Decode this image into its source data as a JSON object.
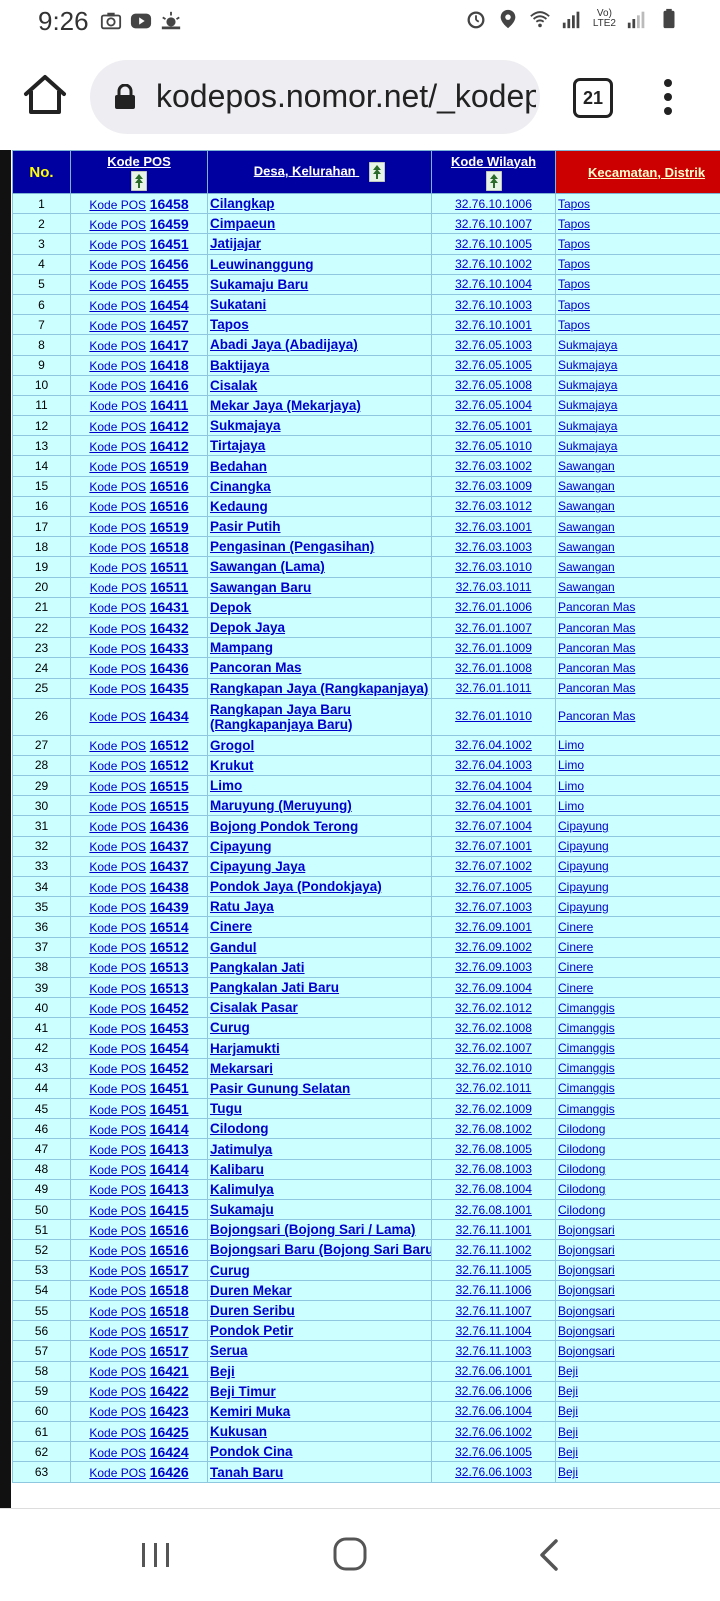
{
  "status_bar": {
    "time": "9:26",
    "left_icons": [
      "photo-icon",
      "youtube-icon",
      "weather-icon"
    ],
    "right_icons": [
      "alarm-icon",
      "location-icon",
      "wifi-icon",
      "signal-icon",
      "battery-icon"
    ],
    "network_label_top": "Vo)",
    "network_label_bottom": "LTE2"
  },
  "browser": {
    "url": "kodepos.nomor.net/_kodep",
    "tab_count": "21"
  },
  "table": {
    "headers": {
      "no": "No.",
      "kode_pos": "Kode POS",
      "desa": "Desa, Kelurahan",
      "wilayah": "Kode Wilayah",
      "kecamatan": "Kecamatan, Distrik"
    },
    "kode_pos_prefix": "Kode POS",
    "rows": [
      {
        "no": "1",
        "kode": "16458",
        "desa": "Cilangkap",
        "wilayah": "32.76.10.1006",
        "kec": "Tapos"
      },
      {
        "no": "2",
        "kode": "16459",
        "desa": "Cimpaeun",
        "wilayah": "32.76.10.1007",
        "kec": "Tapos"
      },
      {
        "no": "3",
        "kode": "16451",
        "desa": "Jatijajar",
        "wilayah": "32.76.10.1005",
        "kec": "Tapos"
      },
      {
        "no": "4",
        "kode": "16456",
        "desa": "Leuwinanggung",
        "wilayah": "32.76.10.1002",
        "kec": "Tapos"
      },
      {
        "no": "5",
        "kode": "16455",
        "desa": "Sukamaju Baru",
        "wilayah": "32.76.10.1004",
        "kec": "Tapos"
      },
      {
        "no": "6",
        "kode": "16454",
        "desa": "Sukatani",
        "wilayah": "32.76.10.1003",
        "kec": "Tapos"
      },
      {
        "no": "7",
        "kode": "16457",
        "desa": "Tapos",
        "wilayah": "32.76.10.1001",
        "kec": "Tapos"
      },
      {
        "no": "8",
        "kode": "16417",
        "desa": "Abadi Jaya (Abadijaya)",
        "wilayah": "32.76.05.1003",
        "kec": "Sukmajaya"
      },
      {
        "no": "9",
        "kode": "16418",
        "desa": "Baktijaya",
        "wilayah": "32.76.05.1005",
        "kec": "Sukmajaya"
      },
      {
        "no": "10",
        "kode": "16416",
        "desa": "Cisalak",
        "wilayah": "32.76.05.1008",
        "kec": "Sukmajaya"
      },
      {
        "no": "11",
        "kode": "16411",
        "desa": "Mekar Jaya (Mekarjaya)",
        "wilayah": "32.76.05.1004",
        "kec": "Sukmajaya"
      },
      {
        "no": "12",
        "kode": "16412",
        "desa": "Sukmajaya",
        "wilayah": "32.76.05.1001",
        "kec": "Sukmajaya"
      },
      {
        "no": "13",
        "kode": "16412",
        "desa": "Tirtajaya",
        "wilayah": "32.76.05.1010",
        "kec": "Sukmajaya"
      },
      {
        "no": "14",
        "kode": "16519",
        "desa": "Bedahan",
        "wilayah": "32.76.03.1002",
        "kec": "Sawangan"
      },
      {
        "no": "15",
        "kode": "16516",
        "desa": "Cinangka",
        "wilayah": "32.76.03.1009",
        "kec": "Sawangan"
      },
      {
        "no": "16",
        "kode": "16516",
        "desa": "Kedaung",
        "wilayah": "32.76.03.1012",
        "kec": "Sawangan"
      },
      {
        "no": "17",
        "kode": "16519",
        "desa": "Pasir Putih",
        "wilayah": "32.76.03.1001",
        "kec": "Sawangan"
      },
      {
        "no": "18",
        "kode": "16518",
        "desa": "Pengasinan (Pengasihan)",
        "wilayah": "32.76.03.1003",
        "kec": "Sawangan"
      },
      {
        "no": "19",
        "kode": "16511",
        "desa": "Sawangan (Lama)",
        "wilayah": "32.76.03.1010",
        "kec": "Sawangan"
      },
      {
        "no": "20",
        "kode": "16511",
        "desa": "Sawangan Baru",
        "wilayah": "32.76.03.1011",
        "kec": "Sawangan"
      },
      {
        "no": "21",
        "kode": "16431",
        "desa": "Depok",
        "wilayah": "32.76.01.1006",
        "kec": "Pancoran Mas"
      },
      {
        "no": "22",
        "kode": "16432",
        "desa": "Depok Jaya",
        "wilayah": "32.76.01.1007",
        "kec": "Pancoran Mas"
      },
      {
        "no": "23",
        "kode": "16433",
        "desa": "Mampang",
        "wilayah": "32.76.01.1009",
        "kec": "Pancoran Mas"
      },
      {
        "no": "24",
        "kode": "16436",
        "desa": "Pancoran Mas",
        "wilayah": "32.76.01.1008",
        "kec": "Pancoran Mas"
      },
      {
        "no": "25",
        "kode": "16435",
        "desa": "Rangkapan Jaya (Rangkapanjaya)",
        "wilayah": "32.76.01.1011",
        "kec": "Pancoran Mas"
      },
      {
        "no": "26",
        "kode": "16434",
        "desa": "Rangkapan Jaya Baru (Rangkapanjaya Baru)",
        "wilayah": "32.76.01.1010",
        "kec": "Pancoran Mas",
        "tall": true
      },
      {
        "no": "27",
        "kode": "16512",
        "desa": "Grogol",
        "wilayah": "32.76.04.1002",
        "kec": "Limo"
      },
      {
        "no": "28",
        "kode": "16512",
        "desa": "Krukut",
        "wilayah": "32.76.04.1003",
        "kec": "Limo"
      },
      {
        "no": "29",
        "kode": "16515",
        "desa": "Limo",
        "wilayah": "32.76.04.1004",
        "kec": "Limo"
      },
      {
        "no": "30",
        "kode": "16515",
        "desa": "Maruyung (Meruyung)",
        "wilayah": "32.76.04.1001",
        "kec": "Limo"
      },
      {
        "no": "31",
        "kode": "16436",
        "desa": "Bojong Pondok Terong",
        "wilayah": "32.76.07.1004",
        "kec": "Cipayung"
      },
      {
        "no": "32",
        "kode": "16437",
        "desa": "Cipayung",
        "wilayah": "32.76.07.1001",
        "kec": "Cipayung"
      },
      {
        "no": "33",
        "kode": "16437",
        "desa": "Cipayung Jaya",
        "wilayah": "32.76.07.1002",
        "kec": "Cipayung"
      },
      {
        "no": "34",
        "kode": "16438",
        "desa": "Pondok Jaya (Pondokjaya)",
        "wilayah": "32.76.07.1005",
        "kec": "Cipayung"
      },
      {
        "no": "35",
        "kode": "16439",
        "desa": "Ratu Jaya",
        "wilayah": "32.76.07.1003",
        "kec": "Cipayung"
      },
      {
        "no": "36",
        "kode": "16514",
        "desa": "Cinere",
        "wilayah": "32.76.09.1001",
        "kec": "Cinere"
      },
      {
        "no": "37",
        "kode": "16512",
        "desa": "Gandul",
        "wilayah": "32.76.09.1002",
        "kec": "Cinere"
      },
      {
        "no": "38",
        "kode": "16513",
        "desa": "Pangkalan Jati",
        "wilayah": "32.76.09.1003",
        "kec": "Cinere"
      },
      {
        "no": "39",
        "kode": "16513",
        "desa": "Pangkalan Jati Baru",
        "wilayah": "32.76.09.1004",
        "kec": "Cinere"
      },
      {
        "no": "40",
        "kode": "16452",
        "desa": "Cisalak Pasar",
        "wilayah": "32.76.02.1012",
        "kec": "Cimanggis"
      },
      {
        "no": "41",
        "kode": "16453",
        "desa": "Curug",
        "wilayah": "32.76.02.1008",
        "kec": "Cimanggis"
      },
      {
        "no": "42",
        "kode": "16454",
        "desa": "Harjamukti",
        "wilayah": "32.76.02.1007",
        "kec": "Cimanggis"
      },
      {
        "no": "43",
        "kode": "16452",
        "desa": "Mekarsari",
        "wilayah": "32.76.02.1010",
        "kec": "Cimanggis"
      },
      {
        "no": "44",
        "kode": "16451",
        "desa": "Pasir Gunung Selatan",
        "wilayah": "32.76.02.1011",
        "kec": "Cimanggis"
      },
      {
        "no": "45",
        "kode": "16451",
        "desa": "Tugu",
        "wilayah": "32.76.02.1009",
        "kec": "Cimanggis"
      },
      {
        "no": "46",
        "kode": "16414",
        "desa": "Cilodong",
        "wilayah": "32.76.08.1002",
        "kec": "Cilodong"
      },
      {
        "no": "47",
        "kode": "16413",
        "desa": "Jatimulya",
        "wilayah": "32.76.08.1005",
        "kec": "Cilodong"
      },
      {
        "no": "48",
        "kode": "16414",
        "desa": "Kalibaru",
        "wilayah": "32.76.08.1003",
        "kec": "Cilodong"
      },
      {
        "no": "49",
        "kode": "16413",
        "desa": "Kalimulya",
        "wilayah": "32.76.08.1004",
        "kec": "Cilodong"
      },
      {
        "no": "50",
        "kode": "16415",
        "desa": "Sukamaju",
        "wilayah": "32.76.08.1001",
        "kec": "Cilodong"
      },
      {
        "no": "51",
        "kode": "16516",
        "desa": "Bojongsari (Bojong Sari / Lama)",
        "wilayah": "32.76.11.1001",
        "kec": "Bojongsari"
      },
      {
        "no": "52",
        "kode": "16516",
        "desa": "Bojongsari Baru (Bojong Sari Baru)",
        "wilayah": "32.76.11.1002",
        "kec": "Bojongsari"
      },
      {
        "no": "53",
        "kode": "16517",
        "desa": "Curug",
        "wilayah": "32.76.11.1005",
        "kec": "Bojongsari"
      },
      {
        "no": "54",
        "kode": "16518",
        "desa": "Duren Mekar",
        "wilayah": "32.76.11.1006",
        "kec": "Bojongsari"
      },
      {
        "no": "55",
        "kode": "16518",
        "desa": "Duren Seribu",
        "wilayah": "32.76.11.1007",
        "kec": "Bojongsari"
      },
      {
        "no": "56",
        "kode": "16517",
        "desa": "Pondok Petir",
        "wilayah": "32.76.11.1004",
        "kec": "Bojongsari"
      },
      {
        "no": "57",
        "kode": "16517",
        "desa": "Serua",
        "wilayah": "32.76.11.1003",
        "kec": "Bojongsari"
      },
      {
        "no": "58",
        "kode": "16421",
        "desa": "Beji",
        "wilayah": "32.76.06.1001",
        "kec": "Beji"
      },
      {
        "no": "59",
        "kode": "16422",
        "desa": "Beji Timur",
        "wilayah": "32.76.06.1006",
        "kec": "Beji"
      },
      {
        "no": "60",
        "kode": "16423",
        "desa": "Kemiri Muka",
        "wilayah": "32.76.06.1004",
        "kec": "Beji"
      },
      {
        "no": "61",
        "kode": "16425",
        "desa": "Kukusan",
        "wilayah": "32.76.06.1002",
        "kec": "Beji"
      },
      {
        "no": "62",
        "kode": "16424",
        "desa": "Pondok Cina",
        "wilayah": "32.76.06.1005",
        "kec": "Beji"
      },
      {
        "no": "63",
        "kode": "16426",
        "desa": "Tanah Baru",
        "wilayah": "32.76.06.1003",
        "kec": "Beji"
      }
    ]
  },
  "nav_bar": {
    "buttons": [
      "recent-apps-icon",
      "home-icon",
      "back-icon"
    ]
  },
  "colors": {
    "header_bg": "#0000a0",
    "header_kecamatan_bg": "#cc0000",
    "row_bg": "#ccffff",
    "link": "#0000cc"
  }
}
